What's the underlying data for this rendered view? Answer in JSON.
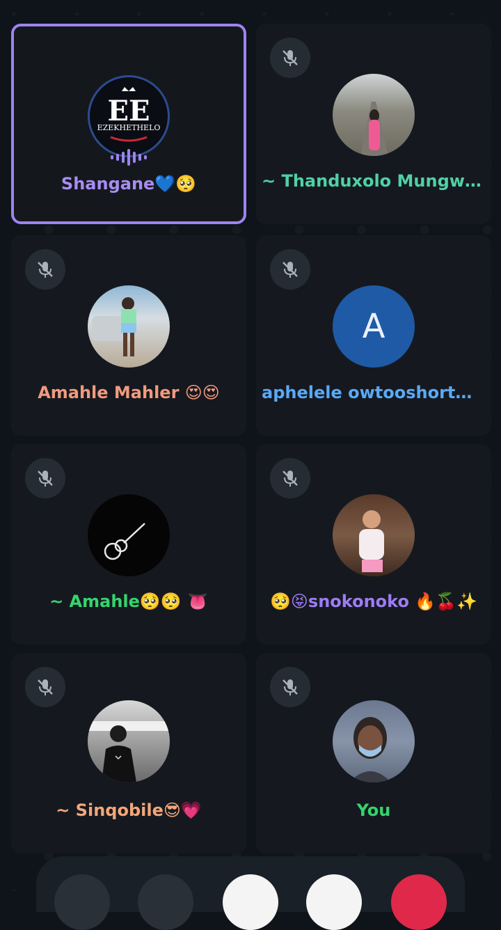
{
  "participants": [
    {
      "name": "Shangane💙🥺",
      "color": "#a88cf2",
      "active": true,
      "muted": false,
      "avatar": "ezekhethelo-logo"
    },
    {
      "name": "~ Thanduxolo Mungwe 🎀",
      "color": "#4fd1a5",
      "muted": true,
      "avatar": "photo-road"
    },
    {
      "name": "Amahle Mahler 😍😍",
      "color": "#f19a7e",
      "muted": true,
      "avatar": "photo-car"
    },
    {
      "name": "aphelele owtooshort🏳️‍🌈🥺...",
      "color": "#5aa9f5",
      "muted": true,
      "avatar": "letter",
      "initial": "A"
    },
    {
      "name": "~ Amahle🥺🥺 👅",
      "color": "#35d46e",
      "muted": true,
      "avatar": "guitar"
    },
    {
      "name": "🥺😝snokonoko 🔥🍒✨",
      "color": "#9d7cf5",
      "muted": true,
      "avatar": "photo-child"
    },
    {
      "name": "~ Sinqobile😎💗",
      "color": "#f4a679",
      "muted": true,
      "avatar": "photo-bw"
    },
    {
      "name": "You",
      "color": "#35d46e",
      "muted": true,
      "avatar": "photo-mask"
    }
  ],
  "logo_text": "EZEKHETHELO",
  "logo_initials": "EE",
  "colors": {
    "active_border": "#9e83ef",
    "tile_bg": "#15191f",
    "end_call": "#e0294a"
  }
}
